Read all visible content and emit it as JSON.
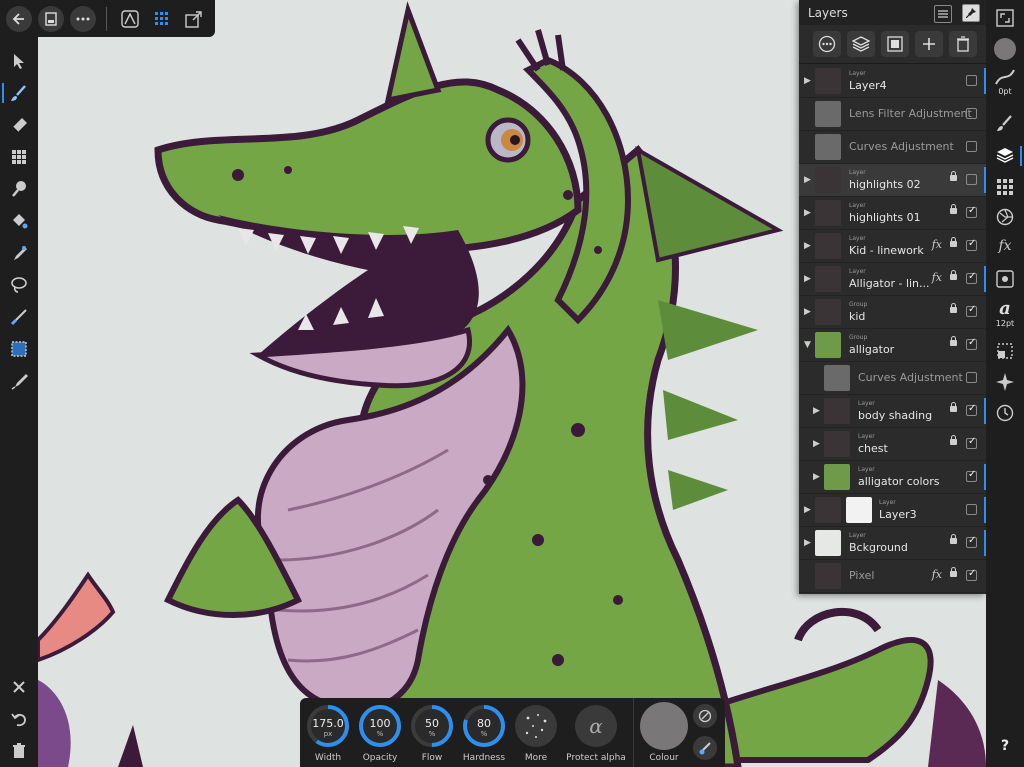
{
  "layers_panel": {
    "title": "Layers",
    "rows": [
      {
        "type": "Layer",
        "name": "Layer4"
      },
      {
        "type": "",
        "name": "Lens Filter Adjustment"
      },
      {
        "type": "",
        "name": "Curves Adjustment"
      },
      {
        "type": "Layer",
        "name": "highlights 02"
      },
      {
        "type": "Layer",
        "name": "highlights 01"
      },
      {
        "type": "Layer",
        "name": "Kid - linework"
      },
      {
        "type": "Layer",
        "name": "Alligator - lin..."
      },
      {
        "type": "Group",
        "name": "kid"
      },
      {
        "type": "Group",
        "name": "alligator"
      },
      {
        "type": "",
        "name": "Curves Adjustment"
      },
      {
        "type": "Layer",
        "name": "body shading"
      },
      {
        "type": "Layer",
        "name": "chest"
      },
      {
        "type": "Layer",
        "name": "alligator colors"
      },
      {
        "type": "Layer",
        "name": "Layer3"
      },
      {
        "type": "Layer",
        "name": "Bckground"
      },
      {
        "type": "",
        "name": "Pixel"
      }
    ],
    "fx_label": "fx"
  },
  "right_strip": {
    "stroke_value": "0pt",
    "font_size": "12pt",
    "fx_label": "fx",
    "text_glyph": "a",
    "help_label": "?"
  },
  "context_bar": {
    "width": {
      "value": "175.0",
      "unit": "px",
      "label": "Width",
      "level": 0.6
    },
    "opacity": {
      "value": "100",
      "unit": "%",
      "label": "Opacity",
      "level": 1.0
    },
    "flow": {
      "value": "50",
      "unit": "%",
      "label": "Flow",
      "level": 0.5
    },
    "hardness": {
      "value": "80",
      "unit": "%",
      "label": "Hardness",
      "level": 0.8
    },
    "more_label": "More",
    "protect_alpha_label": "Protect alpha",
    "protect_alpha_glyph": "α",
    "colour_label": "Colour"
  },
  "colors": {
    "accent": "#2d8ff0",
    "panel": "#2b2b2b",
    "alligator_green": "#74a646",
    "outline": "#3b1a3a",
    "belly": "#c9a9c4"
  }
}
